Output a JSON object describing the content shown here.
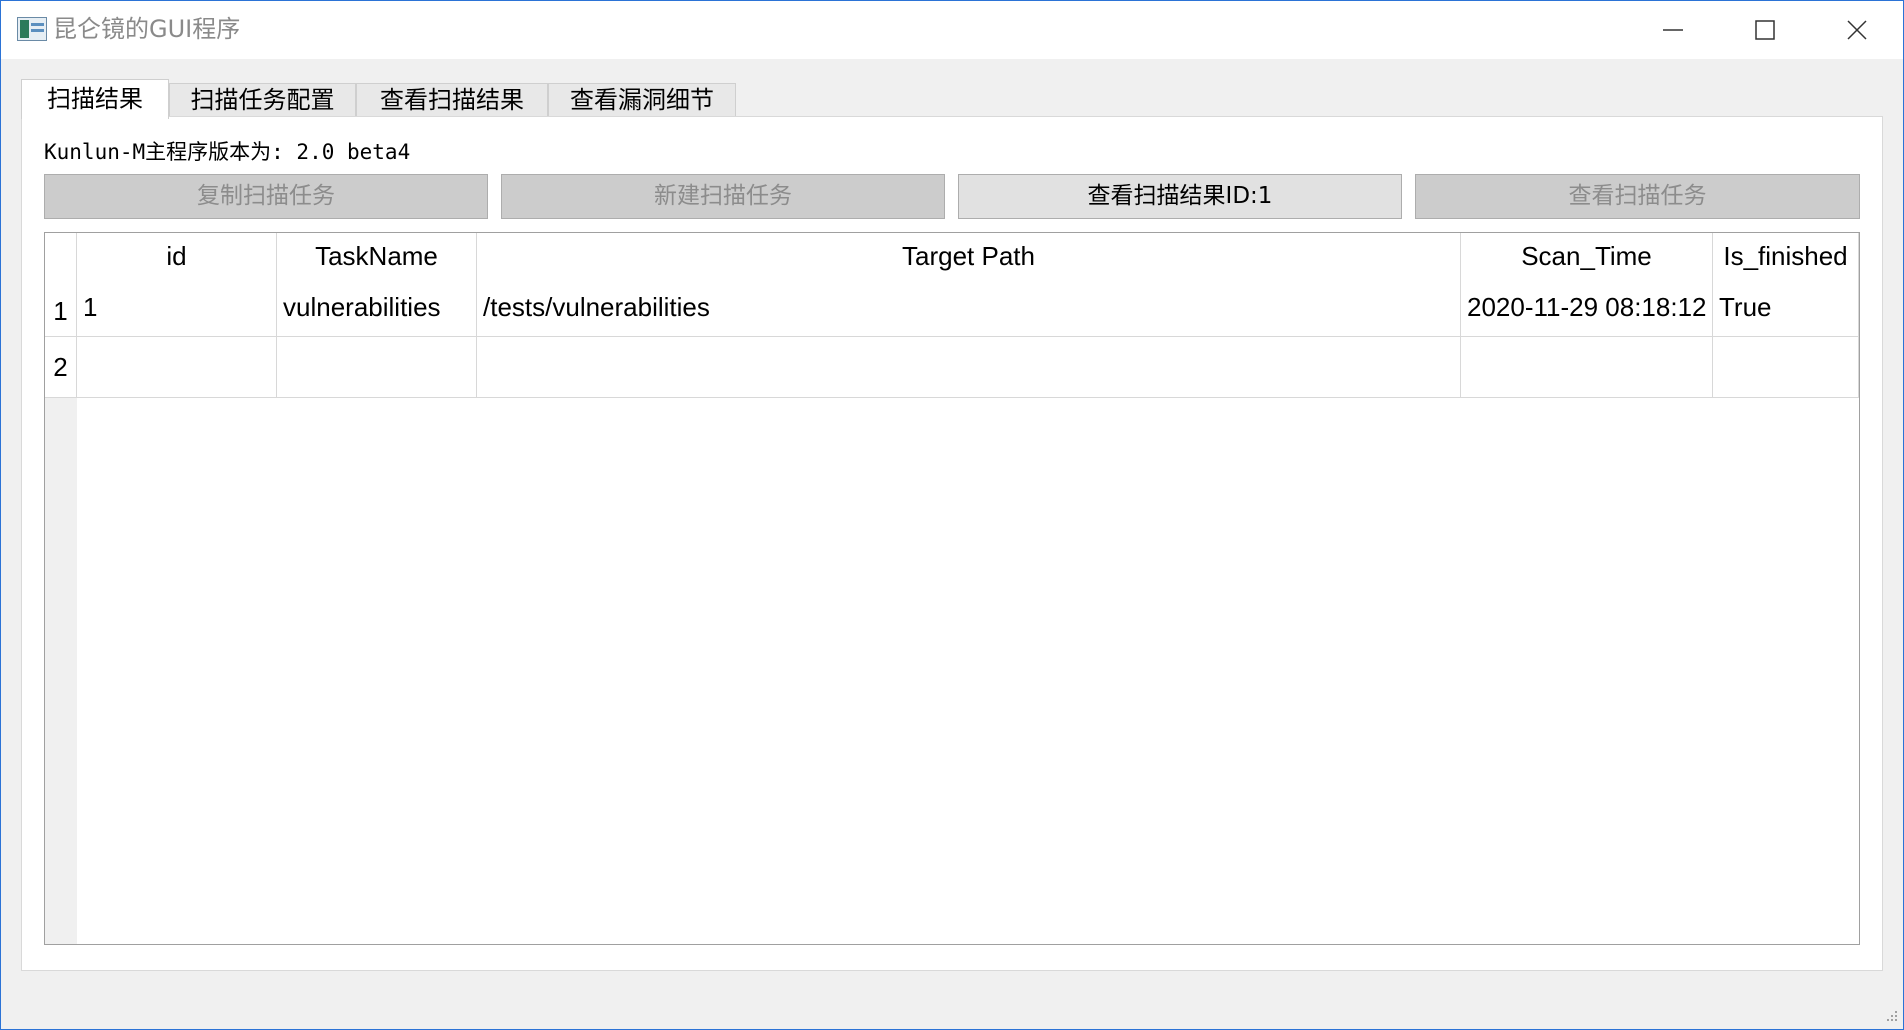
{
  "window": {
    "title": "昆仑镜的GUI程序"
  },
  "tabs": [
    {
      "label": "扫描结果",
      "active": true
    },
    {
      "label": "扫描任务配置",
      "active": false
    },
    {
      "label": "查看扫描结果",
      "active": false
    },
    {
      "label": "查看漏洞细节",
      "active": false
    }
  ],
  "pane": {
    "version_text": "Kunlun-M主程序版本为: 2.0 beta4",
    "buttons": [
      {
        "label": "复制扫描任务",
        "enabled": false
      },
      {
        "label": "新建扫描任务",
        "enabled": false
      },
      {
        "label": "查看扫描结果ID:1",
        "enabled": true
      },
      {
        "label": "查看扫描任务",
        "enabled": false
      }
    ]
  },
  "table": {
    "columns": [
      "id",
      "TaskName",
      "Target Path",
      "Scan_Time",
      "Is_finished"
    ],
    "row_numbers": [
      "1",
      "2"
    ],
    "rows": [
      [
        "1",
        "vulnerabilities",
        "/tests/vulnerabilities",
        "2020-11-29 08:18:12",
        "True"
      ],
      [
        "",
        "",
        "",
        "",
        ""
      ]
    ]
  },
  "icons": {
    "app": "app-window-icon",
    "minimize": "minimize-icon",
    "maximize": "maximize-icon",
    "close": "close-icon",
    "resize": "resize-grip-icon"
  }
}
